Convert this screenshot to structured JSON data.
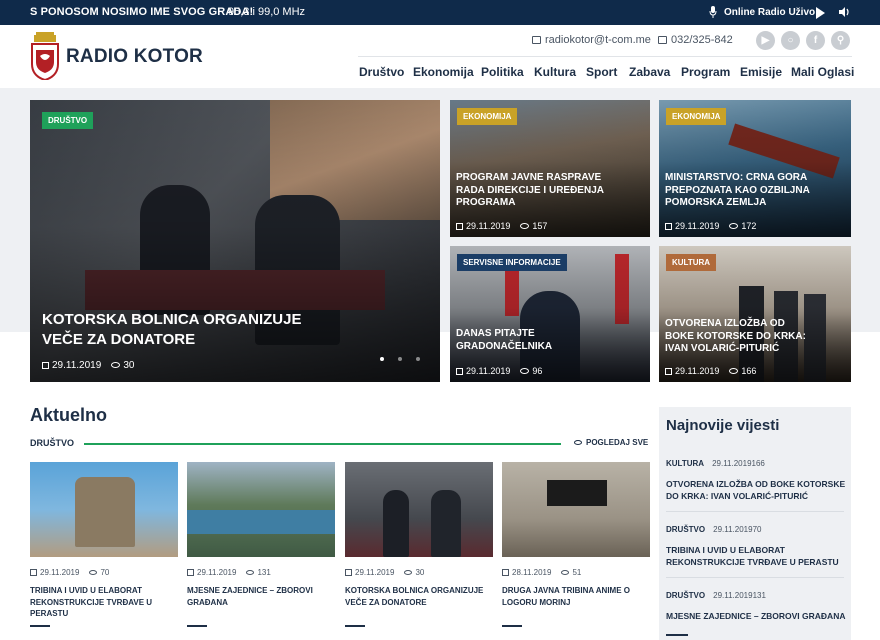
{
  "topbar": {
    "slogan": "S PONOSOM NOSIMO IME SVOG GRADA!",
    "frequency": "95,3 i 99,0 MHz",
    "live_label": "Online Radio Uživo:"
  },
  "header": {
    "logo_text": "RADIO KOTOR",
    "email": "radiokotor@t-com.me",
    "phone": "032/325-842",
    "social_icons": [
      "youtube-icon",
      "instagram-icon",
      "facebook-icon",
      "search-icon"
    ]
  },
  "nav": {
    "items": [
      "Društvo",
      "Ekonomija",
      "Politika",
      "Kultura",
      "Sport",
      "Zabava",
      "Program",
      "Emisije",
      "Mali Oglasi"
    ]
  },
  "hero": {
    "main": {
      "category": "DRUŠTVO",
      "title_line1": "KOTORSKA BOLNICA ORGANIZUJE",
      "title_line2": "VEČE ZA DONATORE",
      "date": "29.11.2019",
      "views": "30"
    },
    "tiles": [
      {
        "category": "EKONOMIJA",
        "l1": "PROGRAM JAVNE RASPRAVE",
        "l2": "RADA DIREKCIJE I UREĐENJA",
        "l3": "PROGRAMA",
        "date": "29.11.2019",
        "views": "157"
      },
      {
        "category": "EKONOMIJA",
        "l1": "MINISTARSTVO: CRNA GORA",
        "l2": "PREPOZNATA KAO OZBILJNA",
        "l3": "POMORSKA ZEMLJA",
        "date": "29.11.2019",
        "views": "172"
      },
      {
        "category": "SERVISNE INFORMACIJE",
        "l1": "DANAS PITAJTE",
        "l2": "GRADONAČELNIKA",
        "l3": "",
        "date": "29.11.2019",
        "views": "96"
      },
      {
        "category": "KULTURA",
        "l1": "OTVORENA IZLOŽBA OD",
        "l2": "BOKE KOTORSKE DO KRKA:",
        "l3": "IVAN VOLARIĆ-PITURIĆ",
        "date": "29.11.2019",
        "views": "166"
      }
    ],
    "slider_dots": 3
  },
  "aktuelno": {
    "title": "Aktuelno",
    "section_label": "DRUŠTVO",
    "see_all": "POGLEDAJ SVE",
    "cards": [
      {
        "date": "29.11.2019",
        "views": "70",
        "title": "TRIBINA I UVID U ELABORAT REKONSTRUKCIJE TVRĐAVE U PERASTU"
      },
      {
        "date": "29.11.2019",
        "views": "131",
        "title": "MJESNE ZAJEDNICE – ZBOROVI GRAĐANA"
      },
      {
        "date": "29.11.2019",
        "views": "30",
        "title": "KOTORSKA BOLNICA ORGANIZUJE VEČE ZA DONATORE"
      },
      {
        "date": "28.11.2019",
        "views": "51",
        "title": "DRUGA JAVNA TRIBINA ANIME O LOGORU MORINJ"
      }
    ]
  },
  "sidebar": {
    "title": "Najnovije vijesti",
    "items": [
      {
        "category": "KULTURA",
        "date": "29.11.2019",
        "views": "166",
        "title": "OTVORENA IZLOŽBA OD BOKE KOTORSKE DO KRKA: IVAN VOLARIĆ-PITURIĆ"
      },
      {
        "category": "DRUŠTVO",
        "date": "29.11.2019",
        "views": "70",
        "title": "TRIBINA I UVID U ELABORAT REKONSTRUKCIJE TVRĐAVE U PERASTU"
      },
      {
        "category": "DRUŠTVO",
        "date": "29.11.2019",
        "views": "131",
        "title": "MJESNE ZAJEDNICE – ZBOROVI GRAĐANA"
      }
    ]
  },
  "colors": {
    "navy": "#0f2a4a",
    "accent_green": "#1fa15a",
    "badge_gold": "#c9a227",
    "badge_brown": "#b06a3a"
  }
}
